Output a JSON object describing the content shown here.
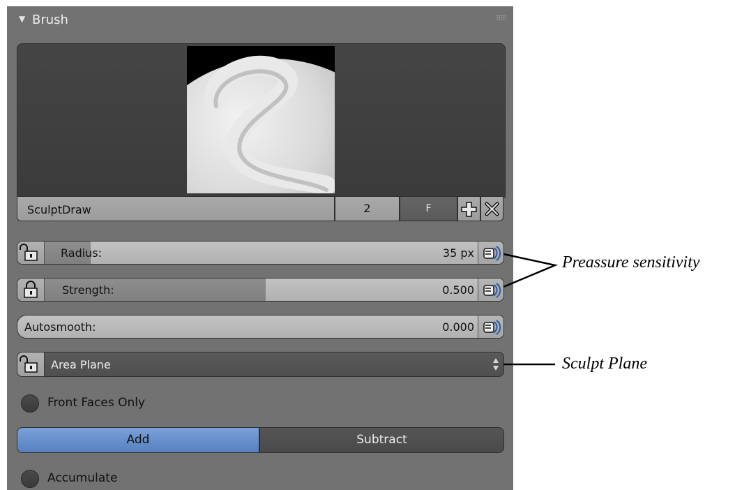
{
  "panel": {
    "title": "Brush",
    "brush_name": "SculptDraw",
    "users_count": "2",
    "fake_user_label": "F"
  },
  "radius": {
    "label": "Radius:",
    "value": "35 px",
    "fill_fraction": 0.12
  },
  "strength": {
    "label": "Strength:",
    "value": "0.500",
    "fill_fraction": 0.5
  },
  "autosmooth": {
    "label": "Autosmooth:",
    "value": "0.000",
    "fill_fraction": 0.0
  },
  "sculpt_plane": {
    "selected": "Area Plane"
  },
  "front_faces_only": {
    "label": "Front Faces Only",
    "checked": false
  },
  "direction": {
    "add_label": "Add",
    "subtract_label": "Subtract",
    "active": "Add"
  },
  "accumulate": {
    "label": "Accumulate",
    "checked": false
  },
  "annotations": {
    "pressure": "Preassure sensitivity",
    "sculpt_plane": "Sculpt Plane"
  },
  "colors": {
    "panel_bg": "#727272",
    "active_blue": "#5680c0",
    "field_dark": "#4f4f4f"
  }
}
